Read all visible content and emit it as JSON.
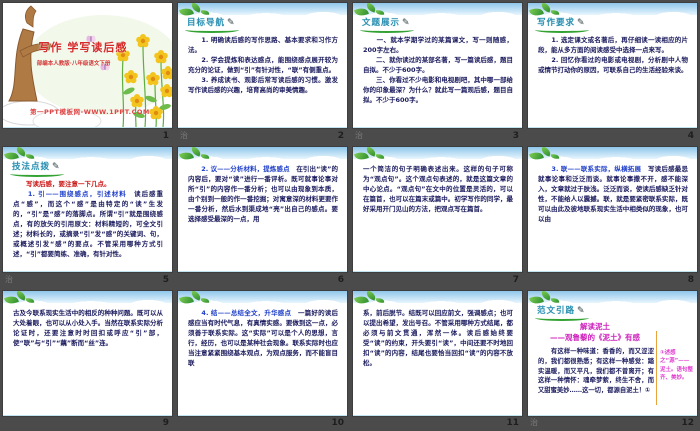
{
  "page": {
    "title": "写作 学写读后感 PPT 预览",
    "background": "#4b4b4b"
  },
  "colors": {
    "board_bg": "#4b4b4b",
    "slide_bg": "#ffffff",
    "header_teal": "#2b8fb0",
    "underline_green": "#33a233",
    "leaf_green": "#3f9b2f",
    "text_navy": "#1b1b5e",
    "text_red": "#cc1414",
    "text_blue": "#1f3fc8",
    "text_magenta": "#cf23bd",
    "cover_red": "#d42a2a",
    "divider_orange": "#e8a33d"
  },
  "icons": {
    "pencil": "✎"
  },
  "slides": [
    {
      "number": "1",
      "type": "cover",
      "title": "写作 学写读后感",
      "subtitle": "部编本人教版·八年级语文下册",
      "footer": "第一PPT模板网-WWW.1PPT.COM"
    },
    {
      "number": "2",
      "header": "目标导航",
      "watermark": "治",
      "segments": [
        {
          "c": "navy",
          "t": "　　1. 明确读后感的写作思路、基本要求和习作方法。\n　　2. 学会提炼和表达感点，能围绕感点展开较为充分的论证，做到“引”有针对性，“联”有侧重点。\n　　3. 养成读书、观影后常写读后感的习惯。激发写作读后感的兴趣，培育高尚的审美情趣。"
        }
      ]
    },
    {
      "number": "3",
      "header": "文题展示",
      "watermark": "治",
      "segments": [
        {
          "c": "navy",
          "t": "　　一、就本学期学过的某篇课文，写一则随感，200字左右。\n　　二、就你读过的某部名著，写一篇读后感，题目自拟。不少于600字。\n　　三、你看过不少电影和电视剧吧，其中哪一部给你的印象最深？为什么？就此写一篇观后感，题目自拟。不少于600字。"
        }
      ]
    },
    {
      "number": "4",
      "header": "写作要求",
      "segments": [
        {
          "c": "navy",
          "t": "　　1. 选定课文或名著后，再仔细读一读相应的片段，能从多方面的阅读感受中选择一点来写。\n　　2. 回忆你看过的电影或电视剧，分析剧中人物或情节打动你的原因，可联系自己的生活经验来谈。"
        }
      ]
    },
    {
      "number": "5",
      "header": "技法点拨",
      "watermark": "治",
      "segments": [
        {
          "c": "red",
          "t": "　　写读后感，要注意一下几点。\n"
        },
        {
          "c": "blue",
          "t": "　　1. 引——围绕感点，引述材料"
        },
        {
          "c": "navy",
          "t": "　读后感重点“感”，而这个“感”是由特定的“读”生发的，“引”是“感”的落脚点。所谓“引”就是围绕感点，有的放矢的引用原文：材料精短的，可全文引述；材料长的，或摘录“引”发“感”的关键词、句，或概述引发“感”的要点。不管采用哪种方式引述，“引”都要简练、准确，有针对性。"
        }
      ]
    },
    {
      "number": "6",
      "segments": [
        {
          "c": "blue",
          "t": "　　2. 议——分析材料，提炼感点"
        },
        {
          "c": "navy",
          "t": "　在引出“读”的内容后，要对“读”进行一番评析。既可就事论事对所“引”的内容作一番分析；也可以由现象到本质，由个别到一般的作一番挖掘；对寓意深的材料更要作一番分析，然后水到渠成地“亮”出自己的感点。要选择感受最深的一点，用"
        }
      ]
    },
    {
      "number": "7",
      "segments": [
        {
          "c": "navy",
          "t": "一个简洁的句子明确表述出来。这样的句子可称为“观点句”。这个观点句表述的，就是这篇文章的中心论点。“观点句”在文中的位置是灵活的，可以在篇首，也可以在篇末或篇中。初学写作的同学，最好采用开门见山的方法，把观点写在篇首。"
        }
      ]
    },
    {
      "number": "8",
      "segments": [
        {
          "c": "blue",
          "t": "　　3. 联——联系实际，纵横拓展"
        },
        {
          "c": "navy",
          "t": "　写读后感最忌就事论事和泛泛而谈。就事论事撒不开，感不能深入，文章就过于肤浅。泛泛而谈，使读后感缺乏针对性，不能给人以震撼。联，就是要紧密联系实际，既可以由此及彼地联系现实生活中相类似的现象，也可以由"
        }
      ]
    },
    {
      "number": "9",
      "segments": [
        {
          "c": "navy",
          "t": "古及今联系现实生活中的相反的种种问题。既可以从大处着眼，也可以从小处入手。当然在联系实际分析论证时，还要注意时时回扣或呼应“引”部，使“联”与“引”“藕”断而“丝”连。"
        }
      ]
    },
    {
      "number": "10",
      "segments": [
        {
          "c": "blue",
          "t": "　　4. 结——总结全文，升华感点"
        },
        {
          "c": "navy",
          "t": "　一篇好的读后感应当有时代气息，有真情实感。要做到这一点，必须善于联系实际。这“实际”可以是个人的思想，言行，经历，也可以是某种社会现象。联系实际时也应当注意紧紧围绕基本观点，为观点服务，而不能盲目联"
        }
      ]
    },
    {
      "number": "11",
      "segments": [
        {
          "c": "navy",
          "t": "系，前后脱节。结既可以回应前文，强调感点；也可以提出希望，发出号召。不管采用哪种方式结尾，都必须与前文贯通，浑然一体。读后感始终要受“读”的约束，开头要引“读”，中间还要不时地回扣“读”的内容，结尾也要恰当回扣“读”的内容不放松。"
        }
      ]
    },
    {
      "number": "12",
      "header": "范文引路",
      "watermark": "治",
      "essay_title_1": "解读泥土",
      "essay_title_2": "——观鲁藜的《泥土》有感",
      "segments": [
        {
          "c": "navy",
          "t": "　　有这样一种味道：香香的，而又涩涩的，我们都很熟悉；有这样一种感觉：踏实温暖，而又平凡，我们都不曾离开；有这样一种情怀：魂牵梦萦，终生不舍，而又甜蜜美妙……这一切，都源自泥土！①"
        }
      ],
      "margin_note": "①述感之“源”——泥土。语句整齐、美妙。"
    }
  ]
}
